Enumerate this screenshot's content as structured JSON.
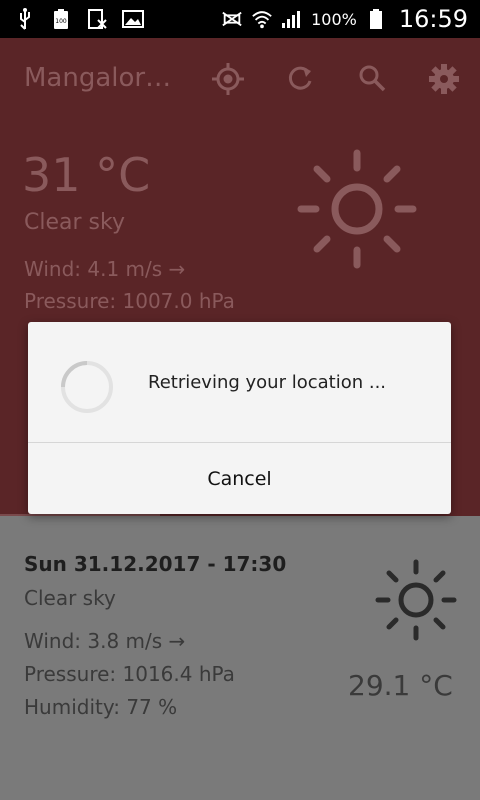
{
  "status_bar": {
    "battery_percent": "100%",
    "time": "16:59",
    "icons": [
      "usb-icon",
      "battery-100-icon",
      "sim-off-icon",
      "image-icon",
      "mute-icon",
      "wifi-icon",
      "signal-icon",
      "battery-icon"
    ]
  },
  "toolbar": {
    "city": "Mangalor…",
    "icons": [
      "location-icon",
      "refresh-icon",
      "search-icon",
      "gear-icon"
    ]
  },
  "current": {
    "temperature": "31 °C",
    "description": "Clear sky",
    "wind": "Wind: 4.1 m/s →",
    "pressure": "Pressure: 1007.0 hPa"
  },
  "dialog": {
    "message": "Retrieving your location ...",
    "cancel_label": "Cancel"
  },
  "forecast": [
    {
      "datetime": "Sun 31.12.2017 - 17:30",
      "description": "Clear sky",
      "wind": "Wind: 3.8 m/s →",
      "pressure": "Pressure: 1016.4 hPa",
      "humidity": "Humidity: 77 %",
      "temperature": "29.1 °C"
    }
  ],
  "colors": {
    "header_bg_dimmed": "#5a2527",
    "header_text_dimmed": "#8a5a5c",
    "forecast_bg_dimmed": "#7a7a7a",
    "dialog_bg": "#f4f4f4"
  }
}
